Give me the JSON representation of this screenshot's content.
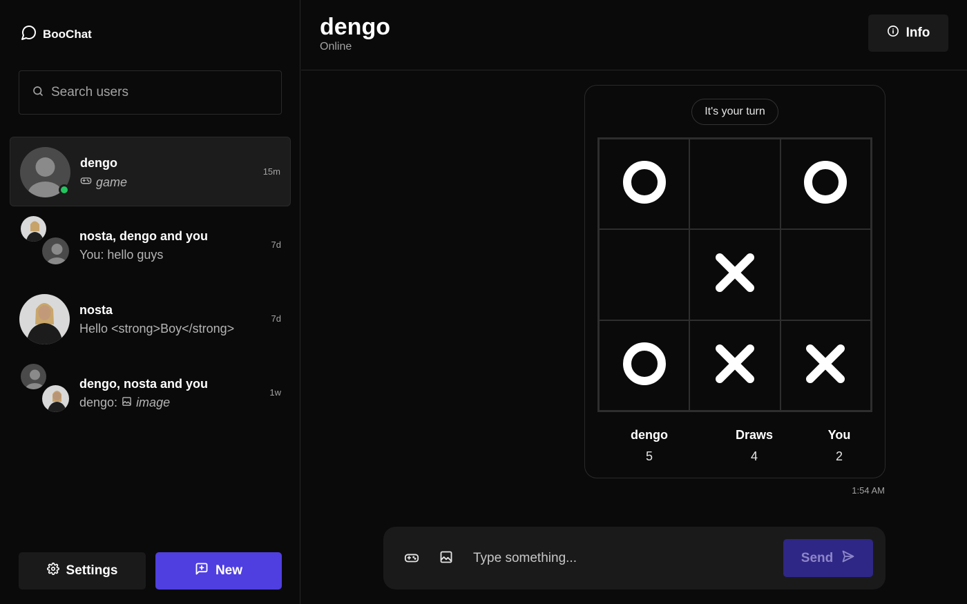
{
  "app": {
    "name": "BooChat"
  },
  "search": {
    "placeholder": "Search users"
  },
  "conversations": [
    {
      "name": "dengo",
      "preview_prefix": "",
      "preview": "game",
      "preview_icon": "gamepad-icon",
      "time": "15m",
      "active": true,
      "online": true
    },
    {
      "name": "nosta, dengo and you",
      "preview_prefix": "",
      "preview": "You: hello guys",
      "time": "7d"
    },
    {
      "name": "nosta",
      "preview_prefix": "",
      "preview": "Hello <strong>Boy</strong>",
      "time": "7d"
    },
    {
      "name": "dengo, nosta and you",
      "preview_prefix": "dengo:",
      "preview": "image",
      "preview_icon": "image-icon",
      "time": "1w"
    }
  ],
  "sidebar_buttons": {
    "settings": "Settings",
    "new": "New"
  },
  "chat": {
    "title": "dengo",
    "status": "Online",
    "info_label": "Info"
  },
  "game": {
    "turn_text": "It's your turn",
    "board": [
      "O",
      "",
      "O",
      "",
      "X",
      "",
      "O",
      "X",
      "X"
    ],
    "scores": [
      {
        "label": "dengo",
        "value": "5"
      },
      {
        "label": "Draws",
        "value": "4"
      },
      {
        "label": "You",
        "value": "2"
      }
    ],
    "time": "1:54 AM"
  },
  "composer": {
    "placeholder": "Type something...",
    "send_label": "Send"
  },
  "colors": {
    "accent": "#4f3fe0",
    "online": "#22c55e",
    "send_disabled": "#2f2785"
  }
}
